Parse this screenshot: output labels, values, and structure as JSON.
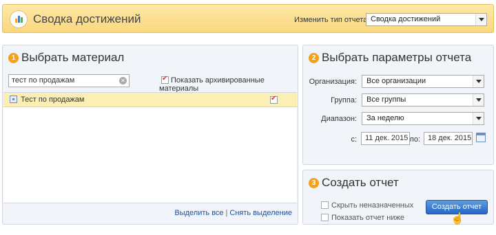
{
  "header": {
    "title": "Сводка достижений",
    "report_type_label": "Изменить тип отчета:",
    "report_type_value": "Сводка достижений"
  },
  "material": {
    "step": "1",
    "title": "Выбрать материал",
    "search_value": "тест по продажам",
    "show_archived_label": "Показать архивированные материалы",
    "show_archived_checked": true,
    "items": [
      {
        "label": "Тест по продажам",
        "checked": true
      }
    ],
    "select_all": "Выделить все",
    "separator": "|",
    "deselect": "Снять выделение"
  },
  "params": {
    "step": "2",
    "title": "Выбрать параметры отчета",
    "org_label": "Организация:",
    "org_value": "Все организации",
    "group_label": "Группа:",
    "group_value": "Все группы",
    "range_label": "Диапазон:",
    "range_value": "За неделю",
    "from_label": "с:",
    "from_value": "11 дек. 2015",
    "to_label": "по:",
    "to_value": "18 дек. 2015"
  },
  "create": {
    "step": "3",
    "title": "Создать отчет",
    "hide_unassigned": "Скрыть неназначенных",
    "show_below": "Показать отчет ниже",
    "button": "Создать отчет"
  },
  "colors": {
    "accent": "#f4a21c",
    "header_bg": "#f9d77e",
    "button": "#2667c4",
    "link": "#1d4f9c"
  }
}
